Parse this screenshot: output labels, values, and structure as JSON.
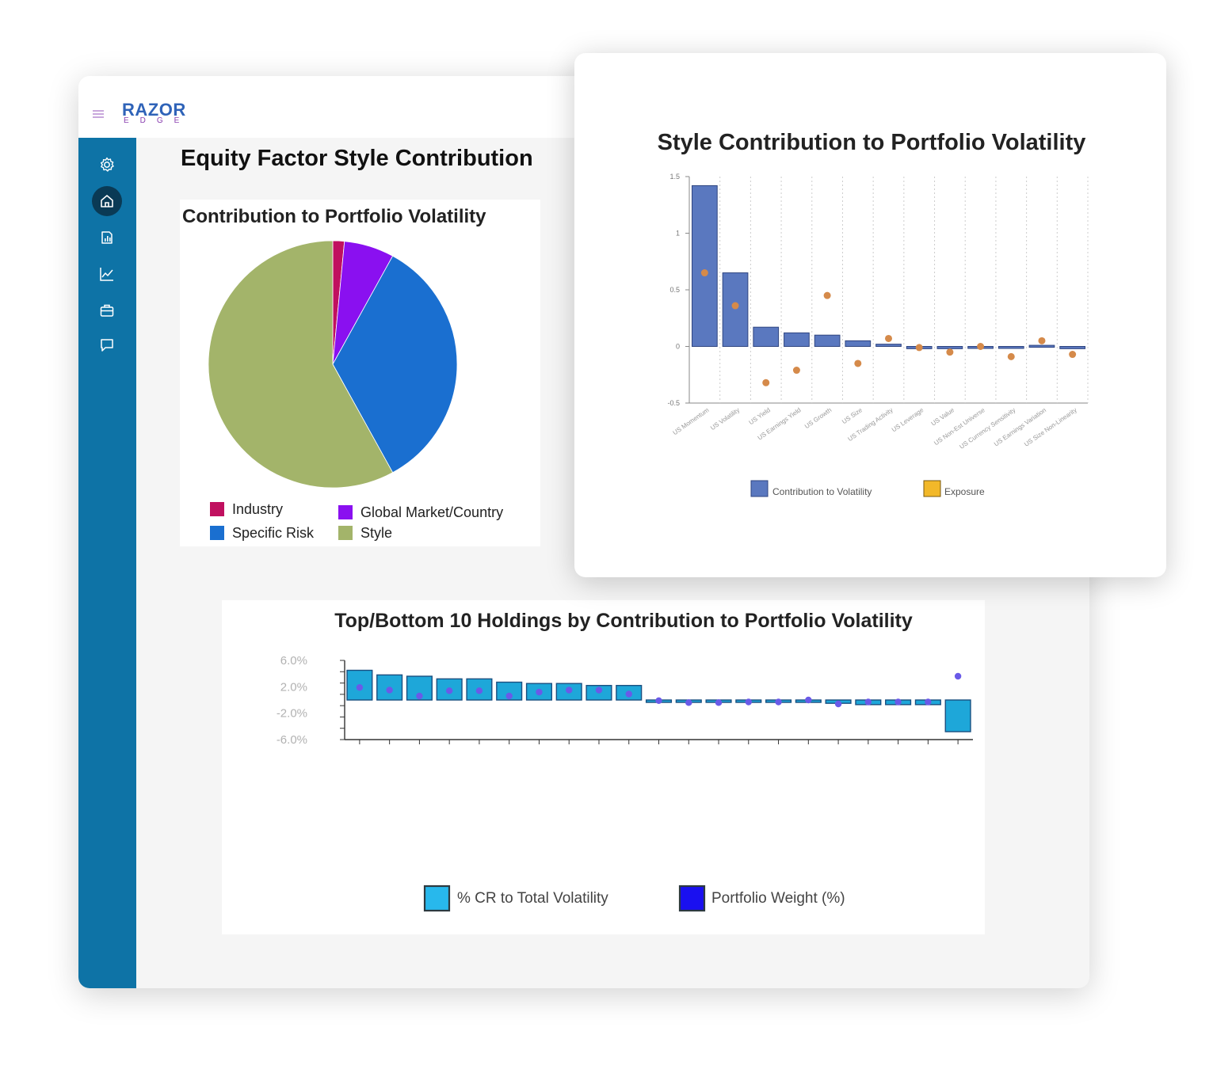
{
  "app": {
    "logo_main": "RAZOR",
    "logo_sub": "EDGE",
    "nav_items": [
      {
        "name": "settings",
        "icon": "gear-icon"
      },
      {
        "name": "home",
        "icon": "home-icon",
        "active": true
      },
      {
        "name": "reports",
        "icon": "report-icon"
      },
      {
        "name": "analytics",
        "icon": "line-chart-icon"
      },
      {
        "name": "portfolio",
        "icon": "briefcase-icon"
      },
      {
        "name": "messages",
        "icon": "chat-icon"
      }
    ]
  },
  "page": {
    "title": "Equity Factor Style Contribution"
  },
  "chart_data": [
    {
      "id": "portfolio-volatility-pie",
      "type": "pie",
      "title": "Contribution to Portfolio Volatility",
      "labels": [
        "Industry",
        "Global Market/Country",
        "Specific Risk",
        "Style"
      ],
      "values": [
        1.5,
        6.5,
        34,
        58
      ],
      "colors": [
        "#c0105f",
        "#8a10f0",
        "#1a6fd0",
        "#a3b46a"
      ],
      "legend": "bottom"
    },
    {
      "id": "style-contribution-chart",
      "type": "bar",
      "title": "Style Contribution to Portfolio Volatility",
      "categories": [
        "US Momentum",
        "US Volatility",
        "US Yield",
        "US Earnings Yield",
        "US Growth",
        "US Size",
        "US Trading Activity",
        "US Leverage",
        "US Value",
        "US Non-Est Universe",
        "US Currency Sensitivity",
        "US Earnings Variation",
        "US Size Non-Linearity"
      ],
      "series": [
        {
          "name": "Contribution to Volatility",
          "values": [
            1.42,
            0.65,
            0.17,
            0.12,
            0.1,
            0.05,
            0.02,
            -0.02,
            -0.02,
            -0.01,
            0.0,
            0.01,
            -0.02
          ],
          "color": "#5a78bf"
        },
        {
          "name": "Exposure",
          "values": [
            0.65,
            0.36,
            -0.32,
            -0.21,
            0.45,
            -0.15,
            0.07,
            -0.01,
            -0.05,
            0.0,
            -0.09,
            0.05,
            -0.07
          ],
          "color": "#e7a13a"
        }
      ],
      "ylim": [
        -0.5,
        1.5
      ],
      "yticks": [
        "1.5",
        "1",
        "0.5",
        "0",
        "-0.5"
      ],
      "legend": "bottom",
      "grid": true
    },
    {
      "id": "holdings-contribution-chart",
      "type": "bar",
      "title": "Top/Bottom 10 Holdings by Contribution to Portfolio Volatility",
      "categories": [
        "",
        "",
        "",
        "",
        "",
        "",
        "",
        "",
        "",
        "",
        "",
        "",
        "",
        "",
        "",
        "",
        "",
        "",
        "",
        "",
        ""
      ],
      "series": [
        {
          "name": "% CR to Total Volatility",
          "values": [
            4.5,
            3.8,
            3.6,
            3.2,
            3.2,
            2.7,
            2.5,
            2.5,
            2.2,
            2.2,
            -0.2,
            -0.3,
            -0.3,
            -0.3,
            -0.3,
            -0.3,
            -0.5,
            -0.7,
            -0.7,
            -0.7,
            -4.8
          ],
          "color": "#1ea7d9"
        },
        {
          "name": "Portfolio Weight (%)",
          "values": [
            1.9,
            1.5,
            0.6,
            1.4,
            1.4,
            0.6,
            1.2,
            1.5,
            1.5,
            0.9,
            -0.1,
            -0.4,
            -0.4,
            -0.3,
            -0.3,
            0.0,
            -0.6,
            -0.3,
            -0.3,
            -0.3,
            3.6
          ],
          "color": "#1a10e0"
        }
      ],
      "yticks": [
        "6.0%",
        "2.0%",
        "-2.0%",
        "-6.0%"
      ],
      "ylim": [
        -6,
        6
      ],
      "legend": "bottom"
    }
  ]
}
